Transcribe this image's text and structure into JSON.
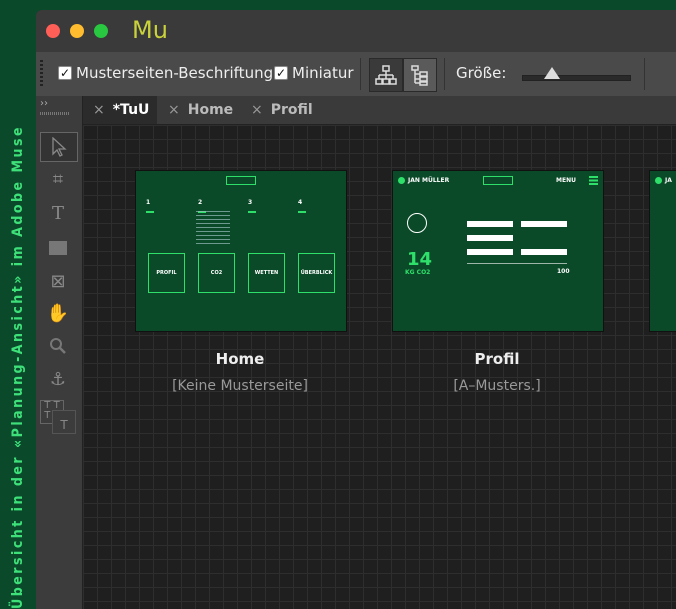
{
  "caption": "Übersicht in der «Planung-Ansicht» im Adobe Muse",
  "app": {
    "name": "Mu"
  },
  "toolbar": {
    "master_label": "Musterseiten-Beschriftung",
    "thumb_label": "Miniatur",
    "size_label": "Größe:",
    "zoom_level": 0.3
  },
  "tabs": [
    {
      "label": "*TuU",
      "active": true
    },
    {
      "label": "Home",
      "active": false
    },
    {
      "label": "Profil",
      "active": false
    }
  ],
  "pages": [
    {
      "name": "Home",
      "master": "[Keine Musterseite]"
    },
    {
      "name": "Profil",
      "master": "[A–Musters.]"
    }
  ],
  "home_thumb": {
    "steps": [
      "1",
      "2",
      "3",
      "4"
    ],
    "tiles": [
      "PROFIL",
      "CO2",
      "WETTEN",
      "ÜBERBLICK"
    ]
  },
  "profil_thumb": {
    "user": "JAN MÜLLER",
    "menu": "MENU",
    "value": "14",
    "unit": "KG CO2",
    "count": "100"
  },
  "third_thumb": {
    "user": "JA"
  }
}
